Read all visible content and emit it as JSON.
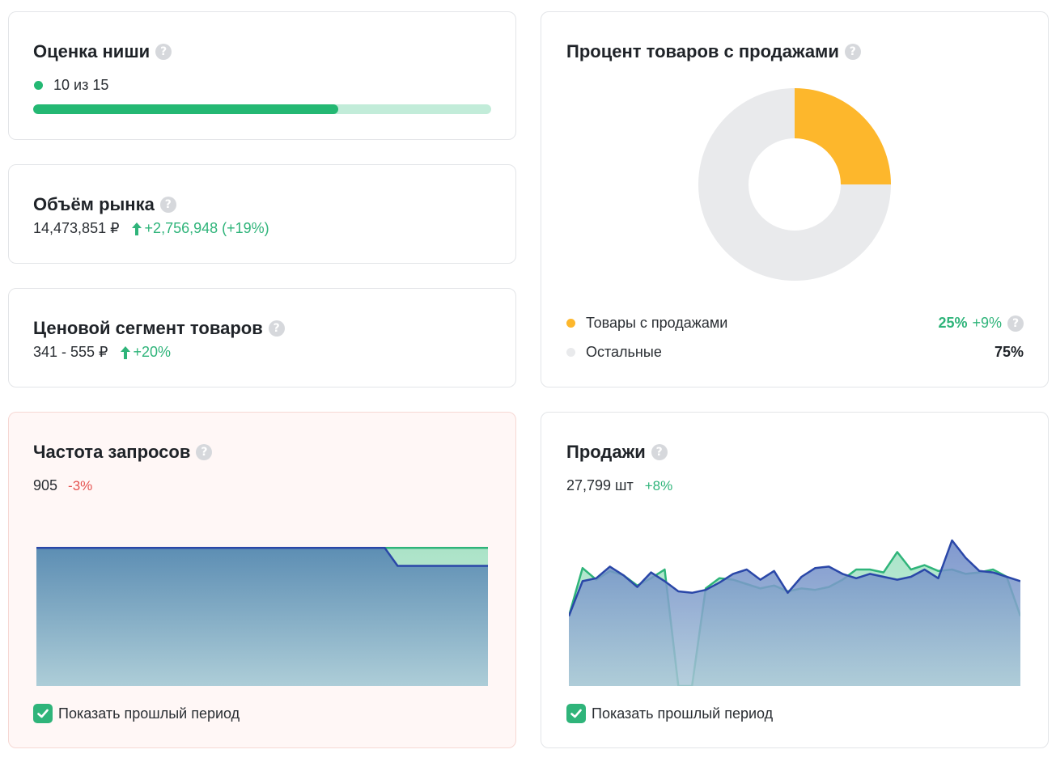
{
  "niche": {
    "title": "Оценка ниши",
    "score_text": "10 из 15",
    "score": 10,
    "max": 15,
    "colors": {
      "fill": "#24b873",
      "track": "#c2ecd9",
      "dot": "#24b873"
    }
  },
  "market": {
    "title": "Объём рынка",
    "value": "14,473,851 ₽",
    "change": "+2,756,948 (+19%)"
  },
  "price": {
    "title": "Ценовой сегмент товаров",
    "value": "341 - 555 ₽",
    "change": "+20%"
  },
  "sales_share": {
    "title": "Процент товаров с продажами",
    "legend": [
      {
        "label": "Товары с продажами",
        "value": "25%",
        "change": "+9%",
        "color": "#fdb72c"
      },
      {
        "label": "Остальные",
        "value": "75%",
        "color": "#e9eaec"
      }
    ],
    "chart_data": {
      "type": "pie",
      "donut": true,
      "categories": [
        "Товары с продажами",
        "Остальные"
      ],
      "values": [
        25,
        75
      ],
      "colors": [
        "#fdb72c",
        "#e9eaec"
      ]
    }
  },
  "queries": {
    "title": "Частота запросов",
    "value": "905",
    "change": "-3%",
    "show_prev_label": "Показать прошлый период",
    "show_prev_checked": true,
    "chart_data": {
      "type": "area",
      "series": [
        {
          "role": "current",
          "color": "#2a47a8",
          "values": [
            1000,
            1000,
            1000,
            1000,
            1000,
            1000,
            1000,
            1000,
            1000,
            1000,
            1000,
            1000,
            1000,
            1000,
            1000,
            1000,
            1000,
            1000,
            1000,
            1000,
            1000,
            1000,
            1000,
            1000,
            1000,
            1000,
            1000,
            1000,
            870,
            870,
            870,
            870,
            870,
            870,
            870,
            870
          ]
        },
        {
          "role": "previous",
          "color": "#2fb47a",
          "values": [
            1000,
            1000,
            1000,
            1000,
            1000,
            1000,
            1000,
            1000,
            1000,
            1000,
            1000,
            1000,
            1000,
            1000,
            1000,
            1000,
            1000,
            1000,
            1000,
            1000,
            1000,
            1000,
            1000,
            1000,
            1000,
            1000,
            1000,
            1000,
            1000,
            1000,
            1000,
            1000,
            1000,
            1000,
            1000,
            1000
          ]
        }
      ],
      "ylim": [
        0,
        1160
      ],
      "grid": false
    }
  },
  "sales": {
    "title": "Продажи",
    "value": "27,799 шт",
    "change": "+8%",
    "show_prev_label": "Показать прошлый период",
    "show_prev_checked": true,
    "chart_data": {
      "type": "area",
      "series": [
        {
          "role": "current",
          "color": "#2a47a8",
          "values": [
            480,
            720,
            740,
            820,
            760,
            680,
            780,
            720,
            650,
            640,
            660,
            710,
            770,
            800,
            730,
            790,
            640,
            750,
            810,
            820,
            770,
            740,
            770,
            750,
            730,
            750,
            800,
            740,
            1000,
            880,
            790,
            780,
            750,
            720
          ]
        },
        {
          "role": "previous",
          "color": "#2fb47a",
          "values": [
            480,
            810,
            730,
            790,
            760,
            690,
            740,
            800,
            0,
            0,
            670,
            740,
            730,
            700,
            670,
            690,
            650,
            670,
            660,
            680,
            730,
            800,
            800,
            780,
            920,
            800,
            830,
            790,
            800,
            770,
            780,
            800,
            750,
            480
          ]
        }
      ],
      "ylim": [
        0,
        1100
      ],
      "grid": false
    }
  }
}
